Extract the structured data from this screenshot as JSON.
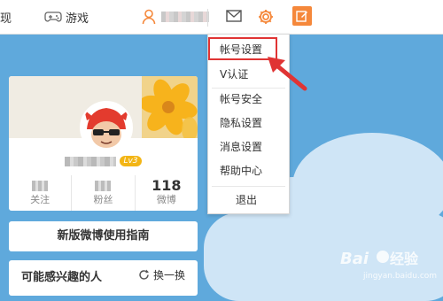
{
  "nav": {
    "discover_label": "发现",
    "game_label": "游戏"
  },
  "card": {
    "level": "Lv3",
    "stats": [
      {
        "label": "关注",
        "value": ""
      },
      {
        "label": "粉丝",
        "value": ""
      },
      {
        "label": "微博",
        "value": "118"
      }
    ]
  },
  "guide_label": "新版微博使用指南",
  "recommend": {
    "title": "可能感兴趣的人",
    "refresh_label": "换一换"
  },
  "dropdown": {
    "items": [
      "帐号设置",
      "V认证",
      "帐号安全",
      "隐私设置",
      "消息设置",
      "帮助中心",
      "退出"
    ]
  },
  "colors": {
    "accent_orange": "#f5883b",
    "highlight_red": "#e03434",
    "sky_blue": "#5fa9dc"
  },
  "icons": [
    "gamepad-icon",
    "user-icon",
    "mail-icon",
    "gear-icon",
    "edit-icon",
    "refresh-icon"
  ],
  "watermark": {
    "text": "Baidu经验",
    "sub": "jingyan.baidu.com"
  }
}
